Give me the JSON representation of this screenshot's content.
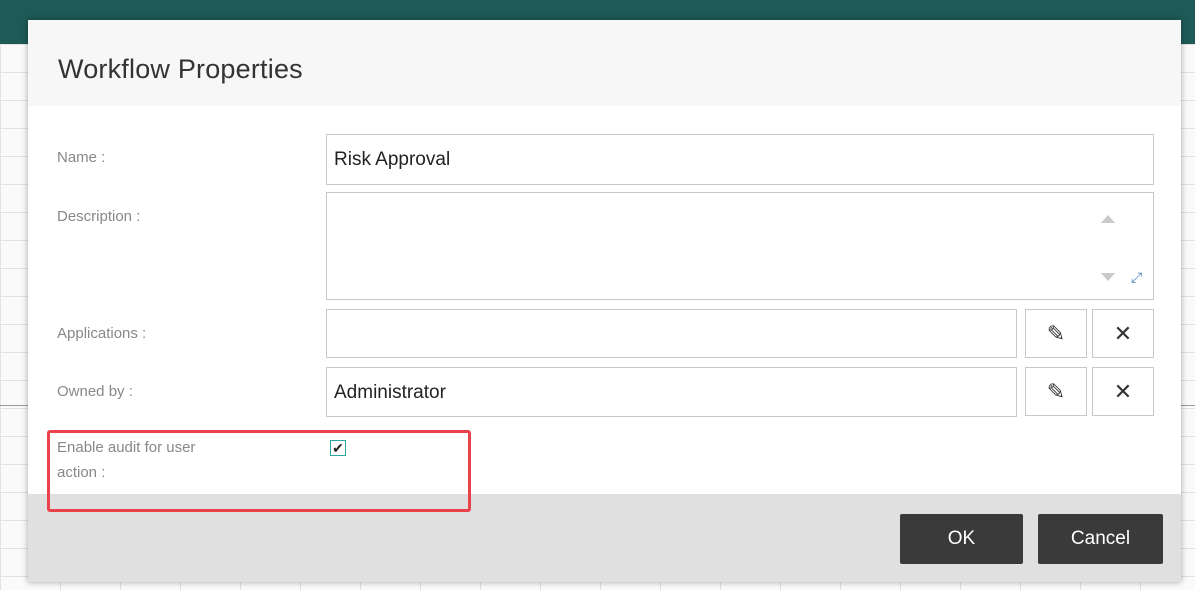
{
  "dialog": {
    "title": "Workflow Properties",
    "fields": {
      "name": {
        "label": "Name :",
        "value": "Risk Approval"
      },
      "description": {
        "label": "Description :",
        "value": ""
      },
      "applications": {
        "label": "Applications :",
        "value": ""
      },
      "owned_by": {
        "label": "Owned by :",
        "value": "Administrator"
      },
      "audit": {
        "label_line1": "Enable audit for user",
        "label_line2": "action :",
        "checked": true
      }
    },
    "icons": {
      "edit": "pencil-icon",
      "clear": "close-icon",
      "expand": "expand-icon",
      "scroll_up": "arrow-up-icon",
      "scroll_down": "arrow-down-icon",
      "check": "checkmark-icon"
    },
    "glyphs": {
      "edit": "✎",
      "clear": "✕",
      "expand": "⤢",
      "check": "✔"
    },
    "buttons": {
      "ok": "OK",
      "cancel": "Cancel"
    }
  },
  "colors": {
    "topbar": "#1f5a57",
    "highlight": "#e8424a",
    "button_dark": "#3a3a3a"
  }
}
